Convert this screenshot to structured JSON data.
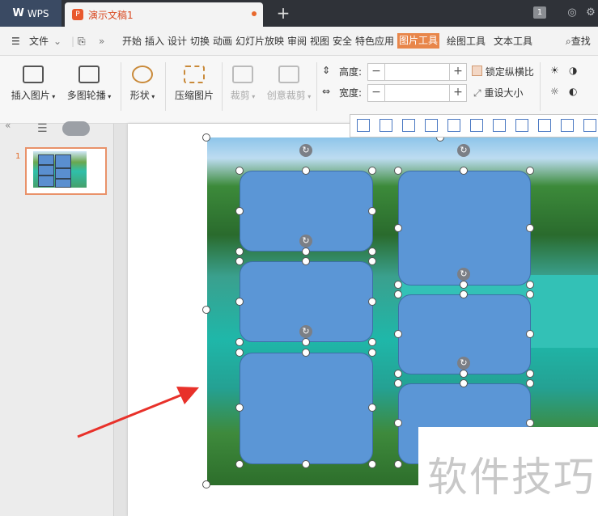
{
  "titlebar": {
    "app_tab": "WPS",
    "doc_tab": "演示文稿1",
    "new_tab": "+",
    "page_indicator": "1"
  },
  "menubar": {
    "file": "文件",
    "items": [
      "开始",
      "插入",
      "设计",
      "切换",
      "动画",
      "幻灯片放映",
      "审阅",
      "视图",
      "安全",
      "特色应用",
      "图片工具",
      "绘图工具",
      "文本工具"
    ],
    "active": "图片工具",
    "search": "查找"
  },
  "ribbon": {
    "insert_picture": "插入图片",
    "multi_carousel": "多图轮播",
    "shape": "形状",
    "compress": "压缩图片",
    "crop": "裁剪",
    "creative_crop": "创意裁剪",
    "height_label": "高度:",
    "width_label": "宽度:",
    "minus": "−",
    "plus": "+",
    "lock_ratio": "锁定纵横比",
    "reset_size": "重设大小"
  },
  "sidebar": {
    "collapse_glyph": "«",
    "slide_number": "1"
  },
  "watermark": "软件技巧",
  "colors": {
    "accent": "#e8864a",
    "shape_fill": "#5b96d6",
    "titlebar": "#2f3238",
    "arrow": "#e8312a"
  }
}
